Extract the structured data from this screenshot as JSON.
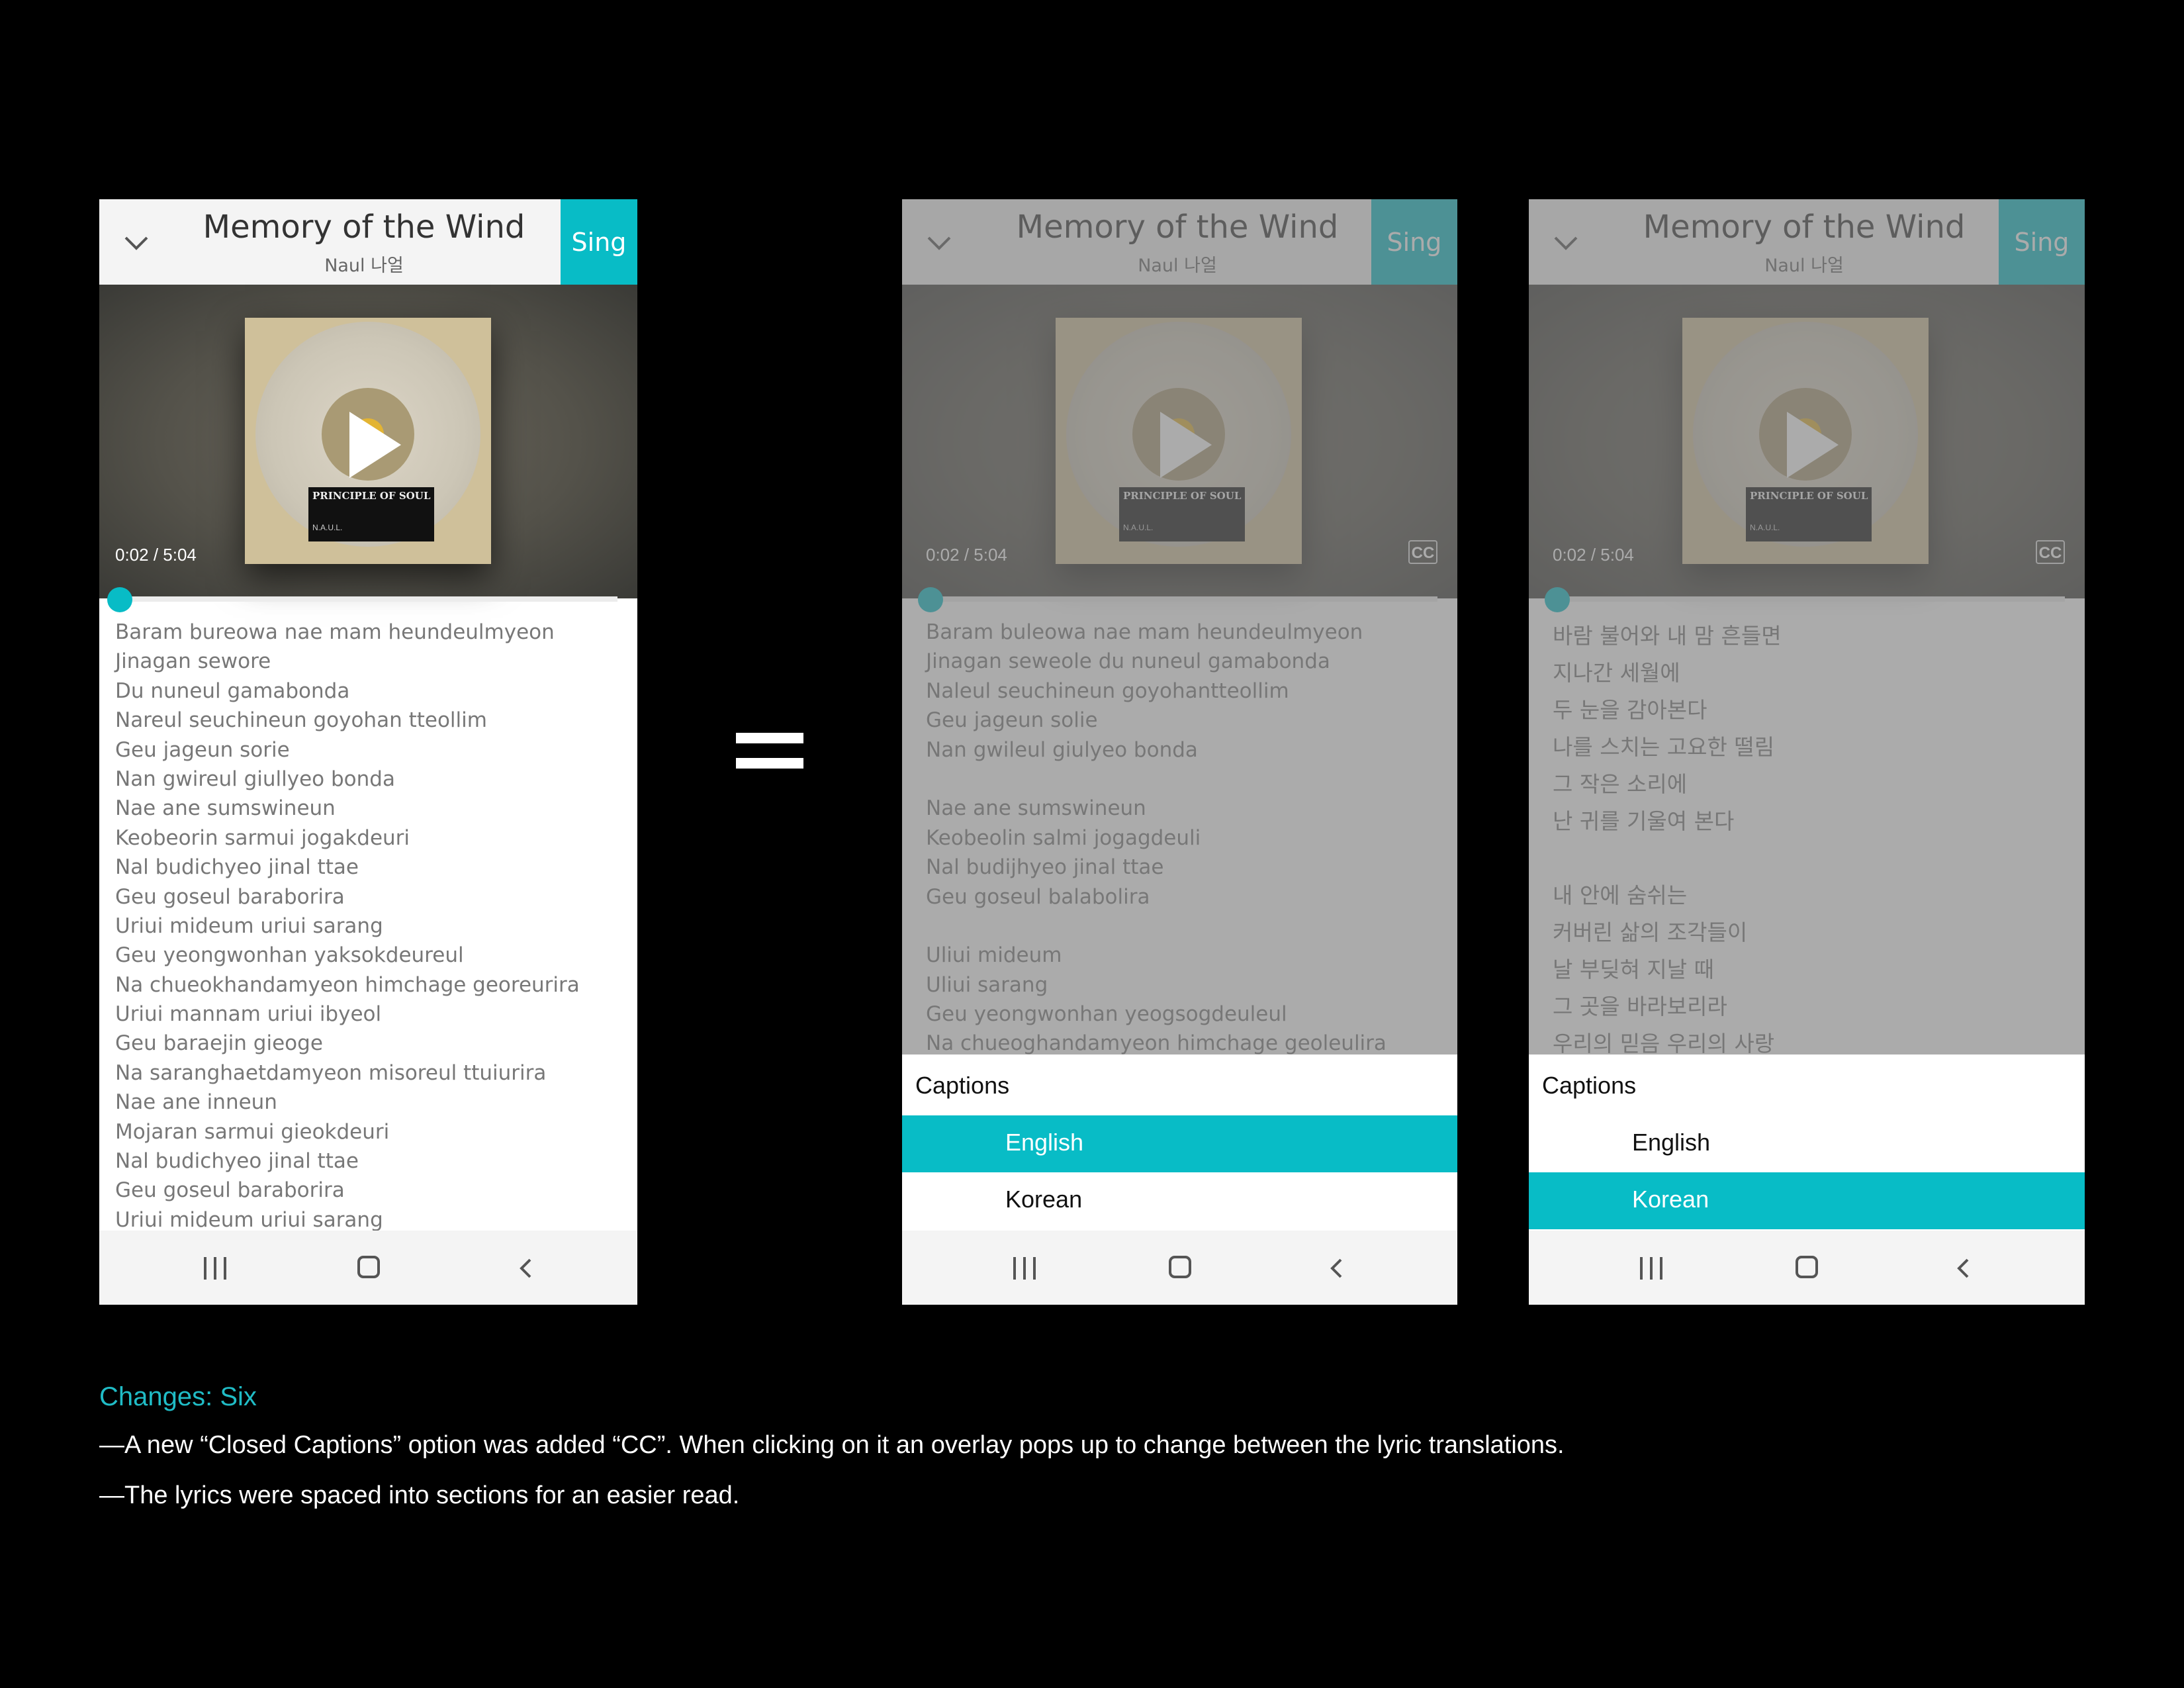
{
  "song": {
    "title": "Memory of the Wind",
    "artist": "Naul 나얼",
    "sing_label": "Sing",
    "time": "0:02 / 5:04",
    "cc_label": "CC",
    "album_text": "PRINCIPLE OF SOUL",
    "album_small": "N.A.U.L."
  },
  "lyrics_original": [
    "Baram bureowa nae mam heundeulmyeon",
    "Jinagan sewore",
    "Du nuneul gamabonda",
    "Nareul seuchineun goyohan tteollim",
    "Geu jageun sorie",
    "Nan gwireul giullyeo bonda",
    "Nae ane sumswineun",
    "Keobeorin sarmui jogakdeuri",
    "Nal budichyeo jinal ttae",
    "Geu goseul baraborira",
    "Uriui mideum uriui sarang",
    "Geu yeongwonhan yaksokdeureul",
    "Na chueokhandamyeon himchage georeurira",
    "Uriui mannam uriui ibyeol",
    "Geu baraejin gieoge",
    "Na saranghaetdamyeon misoreul ttuiurira",
    "Nae ane inneun",
    "Mojaran sarmui gieokdeuri",
    "Nal budichyeo jinal ttae",
    "Geu goseul baraborira",
    "Uriui mideum uriui sarang"
  ],
  "lyrics_english": [
    "Baram buleowa nae mam heundeulmyeon",
    "Jinagan seweole du nuneul gamabonda",
    "Naleul seuchineun goyohantteollim",
    "Geu jageun solie",
    "Nan gwileul giulyeo bonda",
    "",
    "Nae ane sumswineun",
    "Keobeolin salmi jogagdeuli",
    "Nal budijhyeo jinal ttae",
    "Geu goseul balabolira",
    "",
    "Uliui mideum",
    "Uliui sarang",
    "Geu yeongwonhan yeogsogdeuleul",
    "Na chueoghandamyeon himchage geoleulira"
  ],
  "lyrics_korean": [
    "바람 불어와 내 맘 흔들면",
    "지나간 세월에",
    "두 눈을 감아본다",
    "나를 스치는 고요한 떨림",
    "그 작은 소리에",
    "난 귀를 기울여 본다",
    "",
    "내 안에 숨쉬는",
    "커버린 삶의 조각들이",
    "날 부딪혀 지날 때",
    "그 곳을 바라보리라",
    "우리의 믿음 우리의 사랑"
  ],
  "captions": {
    "title": "Captions",
    "options": [
      "English",
      "Korean"
    ]
  },
  "notes": {
    "title": "Changes: Six",
    "line1": "—A new “Closed Captions” option was added “CC”. When clicking on it an overlay pops up to change between the lyric translations.",
    "line2": "—The lyrics were spaced into sections for an easier read."
  },
  "colors": {
    "accent": "#08bcc6",
    "notes_title": "#20bcc6",
    "background": "#000000"
  },
  "icons": [
    "chevron-down-icon",
    "play-icon",
    "cc-icon",
    "recent-apps-icon",
    "home-icon",
    "back-icon"
  ]
}
